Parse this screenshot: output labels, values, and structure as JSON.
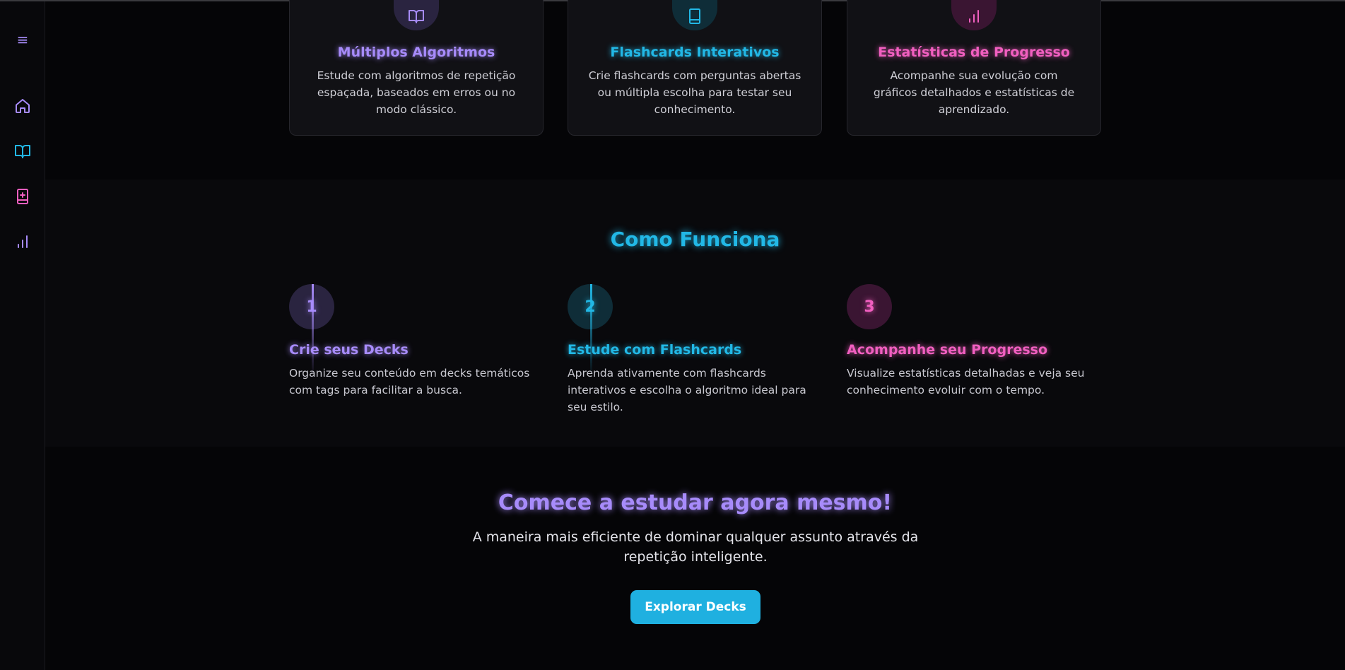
{
  "sidebar": {
    "menu_glyph": "≡",
    "items": [
      {
        "icon": "home-icon",
        "color": "#a78bfa"
      },
      {
        "icon": "book-open-icon",
        "color": "#22b8e6"
      },
      {
        "icon": "book-plus-icon",
        "color": "#f15fc0"
      },
      {
        "icon": "bar-chart-icon",
        "color": "#a78bfa"
      }
    ]
  },
  "features": [
    {
      "title": "Múltiplos Algoritmos",
      "text": "Estude com algoritmos de repetição espaçada, baseados em erros ou no modo clássico.",
      "icon": "book-open-icon",
      "color": "#a78bfa"
    },
    {
      "title": "Flashcards Interativos",
      "text": "Crie flashcards com perguntas abertas ou múltipla escolha para testar seu conhecimento.",
      "icon": "book-icon",
      "color": "#22b8e6"
    },
    {
      "title": "Estatísticas de Progresso",
      "text": "Acompanhe sua evolução com gráficos detalhados e estatísticas de aprendizado.",
      "icon": "bar-chart-icon",
      "color": "#f15fc0"
    }
  ],
  "how": {
    "title": "Como Funciona",
    "steps": [
      {
        "number": "1",
        "title": "Crie seus Decks",
        "text": "Organize seu conteúdo em decks temáticos com tags para facilitar a busca."
      },
      {
        "number": "2",
        "title": "Estude com Flashcards",
        "text": "Aprenda ativamente com flashcards interativos e escolha o algoritmo ideal para seu estilo."
      },
      {
        "number": "3",
        "title": "Acompanhe seu Progresso",
        "text": "Visualize estatísticas detalhadas e veja seu conhecimento evoluir com o tempo."
      }
    ]
  },
  "cta": {
    "title": "Comece a estudar agora mesmo!",
    "text": "A maneira mais eficiente de dominar qualquer assunto através da repetição inteligente.",
    "button": "Explorar Decks"
  },
  "colors": {
    "purple": "#a78bfa",
    "cyan": "#22b8e6",
    "pink": "#f15fc0",
    "background": "#050507"
  }
}
